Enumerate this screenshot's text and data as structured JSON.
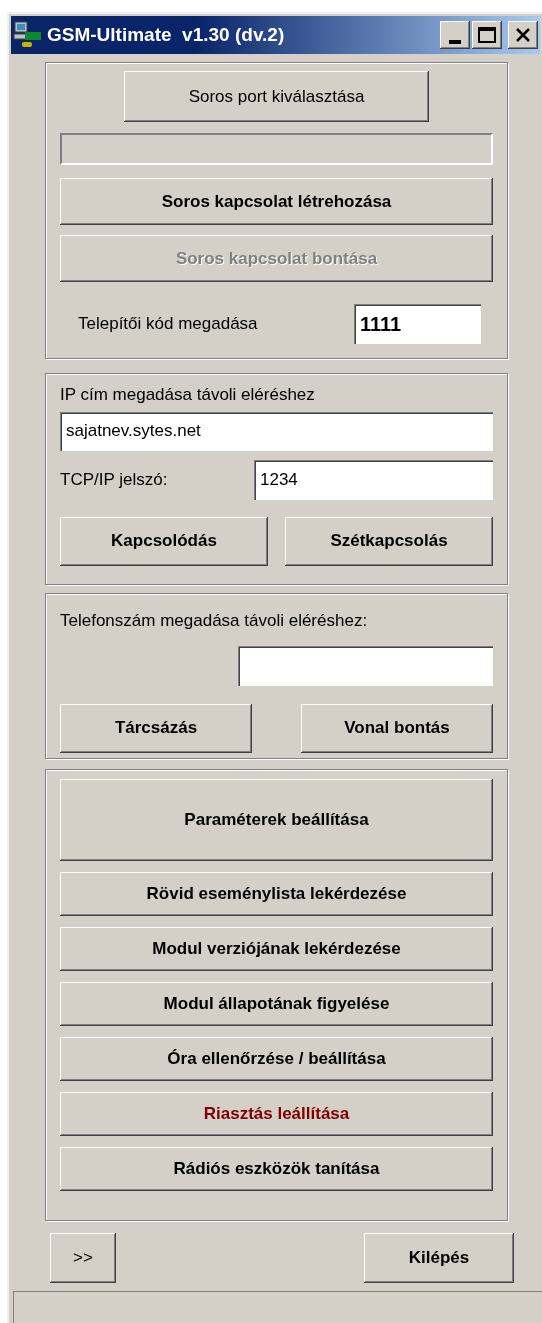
{
  "window": {
    "title": "GSM-Ultimate  v1.30 (dv.2)"
  },
  "serial": {
    "select_port_button": "Soros port kiválasztása",
    "buttons": [
      {
        "label": "Soros kapcsolat létrehozása",
        "disabled": false
      },
      {
        "label": "Soros kapcsolat bontása",
        "disabled": true
      }
    ],
    "installer_code": {
      "label": "Telepítői kód megadása",
      "value": "1111"
    }
  },
  "ip": {
    "label": "IP cím megadása távoli eléréshez",
    "address": "sajatnev.sytes.net",
    "password_label": "TCP/IP jelszó:",
    "password": "1234",
    "buttons": [
      "Kapcsolódás",
      "Szétkapcsolás"
    ]
  },
  "phone": {
    "label": "Telefonszám megadása távoli eléréshez:",
    "buttons": [
      "Tárcsázás",
      "Vonal bontás"
    ]
  },
  "commands": [
    {
      "label": "Paraméterek beállítása",
      "kind": "large",
      "color": "#000000"
    },
    {
      "label": "Rövid eseménylista lekérdezése",
      "kind": "normal",
      "color": "#000000"
    },
    {
      "label": "Modul verziójának lekérdezése",
      "kind": "normal",
      "color": "#000000"
    },
    {
      "label": "Modul állapotának figyelése",
      "kind": "normal",
      "color": "#000000"
    },
    {
      "label": "Óra ellenőrzése / beállítása",
      "kind": "normal",
      "color": "#000000"
    },
    {
      "label": "Riasztás leállítása",
      "kind": "normal",
      "color": "#800000"
    },
    {
      "label": "Rádiós eszközök tanítása",
      "kind": "normal",
      "color": "#000000"
    }
  ],
  "footer": {
    "more_button": ">>",
    "exit_button": "Kilépés"
  }
}
